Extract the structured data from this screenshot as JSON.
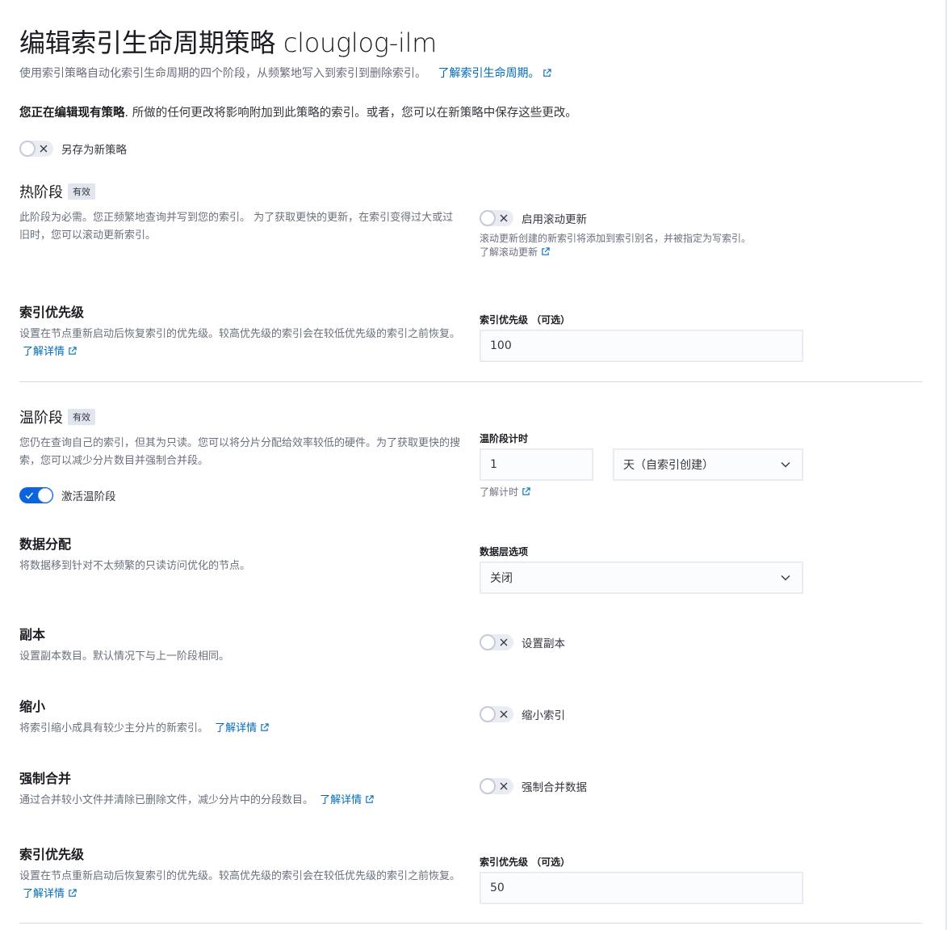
{
  "page": {
    "title": "编辑索引生命周期策略 clouglog-ilm",
    "subtitle": "使用索引策略自动化索引生命周期的四个阶段，从频繁地写入到索引到删除索引。",
    "subtitle_link": "了解索引生命周期。",
    "notice_bold": "您正在编辑现有策略",
    "notice_rest": ". 所做的任何更改将影响附加到此策略的索引。或者，您可以在新策略中保存这些更改。",
    "save_as_new_label": "另存为新策略",
    "save_as_new_on": false
  },
  "hot": {
    "title": "热阶段",
    "badge": "有效",
    "description": "此阶段为必需。您正频繁地查询并写到您的索引。 为了获取更快的更新，在索引变得过大或过旧时，您可以滚动更新索引。",
    "rollover_label": "启用滚动更新",
    "rollover_on": false,
    "rollover_help": "滚动更新创建的新索引将添加到索引别名，并被指定为写索引。",
    "rollover_link": "了解滚动更新",
    "priority_title": "索引优先级",
    "priority_desc": "设置在节点重新启动后恢复索引的优先级。较高优先级的索引会在较低优先级的索引之前恢复。",
    "priority_link": "了解详情",
    "priority_field_label": "索引优先级 （可选）",
    "priority_value": "100"
  },
  "warm": {
    "title": "温阶段",
    "badge": "有效",
    "description": "您仍在查询自己的索引，但其为只读。您可以将分片分配给效率较低的硬件。为了获取更快的搜索，您可以减少分片数目并强制合并段。",
    "activate_label": "激活温阶段",
    "activate_on": true,
    "timing_label": "温阶段计时",
    "timing_value": "1",
    "timing_unit": "天（自索引创建）",
    "timing_link": "了解计时",
    "allocation_title": "数据分配",
    "allocation_desc": "将数据移到针对不太频繁的只读访问优化的节点。",
    "allocation_field_label": "数据层选项",
    "allocation_value": "关闭",
    "replicas_title": "副本",
    "replicas_desc": "设置副本数目。默认情况下与上一阶段相同。",
    "replicas_label": "设置副本",
    "shrink_title": "缩小",
    "shrink_desc": "将索引缩小成具有较少主分片的新索引。",
    "shrink_link": "了解详情",
    "shrink_label": "缩小索引",
    "forcemerge_title": "强制合并",
    "forcemerge_desc": "通过合并较小文件并清除已删除文件，减少分片中的分段数目。",
    "forcemerge_link": "了解详情",
    "forcemerge_label": "强制合并数据",
    "priority_title": "索引优先级",
    "priority_desc": "设置在节点重新启动后恢复索引的优先级。较高优先级的索引会在较低优先级的索引之前恢复。",
    "priority_link": "了解详情",
    "priority_field_label": "索引优先级 （可选）",
    "priority_value": "50"
  },
  "colors": {
    "link": "#006bb8",
    "switch_on": "#0b64dd",
    "badge_bg": "#e0e5ee"
  }
}
